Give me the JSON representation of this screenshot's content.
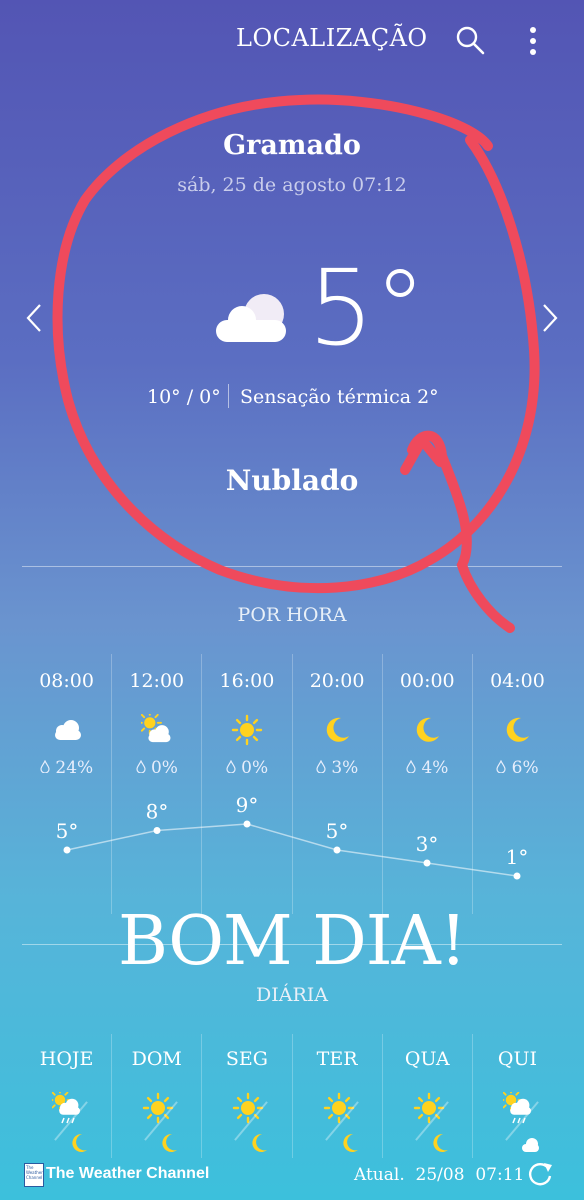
{
  "topbar": {
    "title": "LOCALIZAÇÃO",
    "search_icon": "search-icon",
    "menu_icon": "more-vertical-icon"
  },
  "current": {
    "city": "Gramado",
    "datetime": "sáb, 25 de agosto 07:12",
    "temperature": "5°",
    "icon": "cloud-icon",
    "range": "10° / 0°",
    "feels_like": "Sensação térmica 2°",
    "condition": "Nublado"
  },
  "hourly": {
    "label": "POR HORA",
    "items": [
      {
        "time": "08:00",
        "icon": "cloud-icon",
        "rain": "24%",
        "temp": "5°",
        "value": 5
      },
      {
        "time": "12:00",
        "icon": "sun-cloud-icon",
        "rain": "0%",
        "temp": "8°",
        "value": 8
      },
      {
        "time": "16:00",
        "icon": "sun-icon",
        "rain": "0%",
        "temp": "9°",
        "value": 9
      },
      {
        "time": "20:00",
        "icon": "moon-icon",
        "rain": "3%",
        "temp": "5°",
        "value": 5
      },
      {
        "time": "00:00",
        "icon": "moon-icon",
        "rain": "4%",
        "temp": "3°",
        "value": 3
      },
      {
        "time": "04:00",
        "icon": "moon-icon",
        "rain": "6%",
        "temp": "1°",
        "value": 1
      }
    ]
  },
  "overlay_text": "BOM DIA!",
  "daily": {
    "label": "DIÁRIA",
    "items": [
      {
        "day": "HOJE",
        "icon": "sun-rain-icon"
      },
      {
        "day": "DOM",
        "icon": "sun-icon"
      },
      {
        "day": "SEG",
        "icon": "sun-icon"
      },
      {
        "day": "TER",
        "icon": "sun-icon"
      },
      {
        "day": "QUA",
        "icon": "sun-icon"
      },
      {
        "day": "QUI",
        "icon": "sun-rain-icon"
      }
    ]
  },
  "footer": {
    "logo_text": "The Weather Channel",
    "provider": "The Weather Channel",
    "updated": "Atual.  25/08  07:11",
    "refresh_icon": "refresh-icon"
  },
  "colors": {
    "scribble": "#ef4a5c",
    "sun": "#ffd21f",
    "moon": "#ffd21f"
  }
}
